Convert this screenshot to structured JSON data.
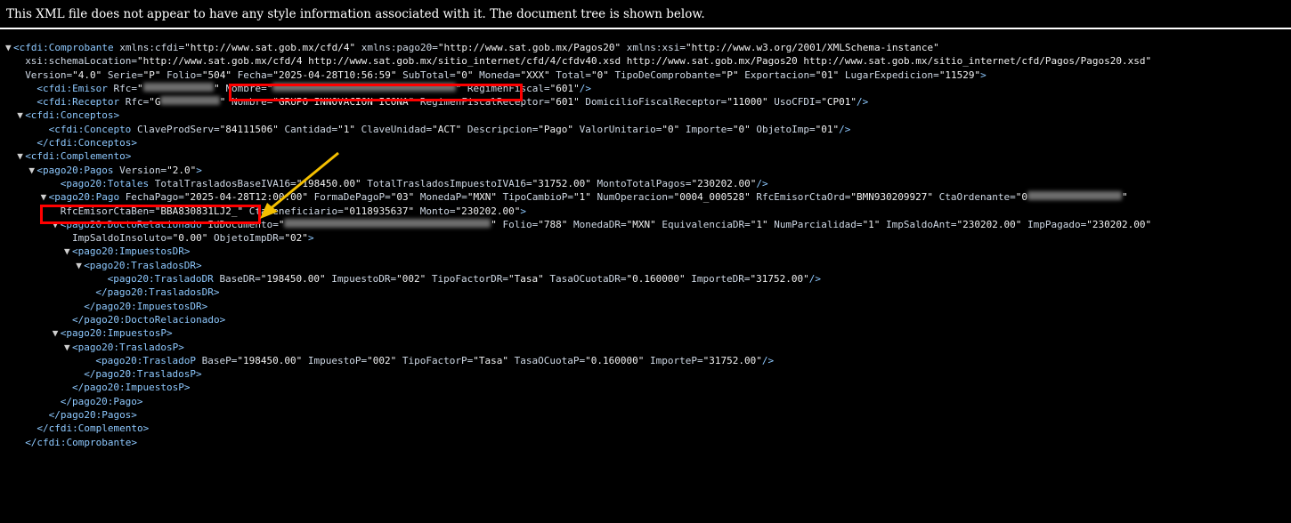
{
  "banner": "This XML file does not appear to have any style information associated with it. The document tree is shown below.",
  "lines": [
    {
      "t": "▼",
      "i": 0,
      "parts": [
        {
          "k": "tag",
          "v": "<cfdi:Comprobante "
        },
        {
          "k": "an",
          "v": "xmlns:cfdi="
        },
        {
          "k": "av",
          "v": "\"http://www.sat.gob.mx/cfd/4\""
        },
        {
          "k": "an",
          "v": " xmlns:pago20="
        },
        {
          "k": "av",
          "v": "\"http://www.sat.gob.mx/Pagos20\""
        },
        {
          "k": "an",
          "v": " xmlns:xsi="
        },
        {
          "k": "av",
          "v": "\"http://www.w3.org/2001/XMLSchema-instance\""
        }
      ]
    },
    {
      "t": "",
      "i": 1,
      "parts": [
        {
          "k": "an",
          "v": "xsi:schemaLocation="
        },
        {
          "k": "av",
          "v": "\"http://www.sat.gob.mx/cfd/4 http://www.sat.gob.mx/sitio_internet/cfd/4/cfdv40.xsd http://www.sat.gob.mx/Pagos20 http://www.sat.gob.mx/sitio_internet/cfd/Pagos/Pagos20.xsd\""
        }
      ]
    },
    {
      "t": "",
      "i": 1,
      "parts": [
        {
          "k": "an",
          "v": "Version="
        },
        {
          "k": "av",
          "v": "\"4.0\""
        },
        {
          "k": "an",
          "v": " Serie="
        },
        {
          "k": "av",
          "v": "\"P\""
        },
        {
          "k": "an",
          "v": " Folio="
        },
        {
          "k": "av",
          "v": "\"504\""
        },
        {
          "k": "an",
          "v": " Fecha="
        },
        {
          "k": "av",
          "v": "\"2025-04-28T10:56:59\""
        },
        {
          "k": "an",
          "v": " SubTotal="
        },
        {
          "k": "av",
          "v": "\"0\""
        },
        {
          "k": "an",
          "v": " Moneda="
        },
        {
          "k": "av",
          "v": "\"XXX\""
        },
        {
          "k": "an",
          "v": " Total="
        },
        {
          "k": "av",
          "v": "\"0\""
        },
        {
          "k": "an",
          "v": " TipoDeComprobante="
        },
        {
          "k": "av",
          "v": "\"P\""
        },
        {
          "k": "an",
          "v": " Exportacion="
        },
        {
          "k": "av",
          "v": "\"01\""
        },
        {
          "k": "an",
          "v": " LugarExpedicion="
        },
        {
          "k": "av",
          "v": "\"11529\""
        },
        {
          "k": "tag",
          "v": ">"
        }
      ]
    },
    {
      "t": "",
      "i": 2,
      "parts": [
        {
          "k": "tag",
          "v": "<cfdi:Emisor "
        },
        {
          "k": "an",
          "v": "Rfc="
        },
        {
          "k": "av",
          "v": "\""
        },
        {
          "k": "blur",
          "v": "XXXXXXXXXXXX"
        },
        {
          "k": "av",
          "v": "\""
        },
        {
          "k": "an",
          "v": " Nombre="
        },
        {
          "k": "av",
          "v": "\""
        },
        {
          "k": "blur",
          "v": "XXXXXXXXXXXXXXXXXXXXXXXXXXXXXXX"
        },
        {
          "k": "av",
          "v": "\""
        },
        {
          "k": "an",
          "v": " RegimenFiscal="
        },
        {
          "k": "av",
          "v": "\"601\""
        },
        {
          "k": "tag",
          "v": "/>"
        }
      ]
    },
    {
      "t": "",
      "i": 2,
      "parts": [
        {
          "k": "tag",
          "v": "<cfdi:Receptor "
        },
        {
          "k": "an",
          "v": "Rfc="
        },
        {
          "k": "av",
          "v": "\"G"
        },
        {
          "k": "blur",
          "v": "XXXXXXXXXX"
        },
        {
          "k": "av",
          "v": "\""
        },
        {
          "k": "an",
          "v": " Nombre="
        },
        {
          "k": "av",
          "v": "\"GRUPO INNOVACION ICONA\""
        },
        {
          "k": "an",
          "v": " RegimenFiscalReceptor="
        },
        {
          "k": "av",
          "v": "\"601\""
        },
        {
          "k": "an",
          "v": " DomicilioFiscalReceptor="
        },
        {
          "k": "av",
          "v": "\"11000\""
        },
        {
          "k": "an",
          "v": " UsoCFDI="
        },
        {
          "k": "av",
          "v": "\"CP01\""
        },
        {
          "k": "tag",
          "v": "/>"
        }
      ]
    },
    {
      "t": "▼",
      "i": 1,
      "parts": [
        {
          "k": "tag",
          "v": "<cfdi:Conceptos>"
        }
      ]
    },
    {
      "t": "",
      "i": 3,
      "parts": [
        {
          "k": "tag",
          "v": "<cfdi:Concepto "
        },
        {
          "k": "an",
          "v": "ClaveProdServ="
        },
        {
          "k": "av",
          "v": "\"84111506\""
        },
        {
          "k": "an",
          "v": " Cantidad="
        },
        {
          "k": "av",
          "v": "\"1\""
        },
        {
          "k": "an",
          "v": " ClaveUnidad="
        },
        {
          "k": "av",
          "v": "\"ACT\""
        },
        {
          "k": "an",
          "v": " Descripcion="
        },
        {
          "k": "av",
          "v": "\"Pago\""
        },
        {
          "k": "an",
          "v": " ValorUnitario="
        },
        {
          "k": "av",
          "v": "\"0\""
        },
        {
          "k": "an",
          "v": " Importe="
        },
        {
          "k": "av",
          "v": "\"0\""
        },
        {
          "k": "an",
          "v": " ObjetoImp="
        },
        {
          "k": "av",
          "v": "\"01\""
        },
        {
          "k": "tag",
          "v": "/>"
        }
      ]
    },
    {
      "t": "",
      "i": 2,
      "parts": [
        {
          "k": "tag",
          "v": "</cfdi:Conceptos>"
        }
      ]
    },
    {
      "t": "▼",
      "i": 1,
      "parts": [
        {
          "k": "tag",
          "v": "<cfdi:Complemento>"
        }
      ]
    },
    {
      "t": "▼",
      "i": 2,
      "parts": [
        {
          "k": "tag",
          "v": "<pago20:Pagos "
        },
        {
          "k": "an",
          "v": "Version="
        },
        {
          "k": "av",
          "v": "\"2.0\""
        },
        {
          "k": "tag",
          "v": ">"
        }
      ]
    },
    {
      "t": "",
      "i": 4,
      "parts": [
        {
          "k": "tag",
          "v": "<pago20:Totales "
        },
        {
          "k": "an",
          "v": "TotalTrasladosBaseIVA16="
        },
        {
          "k": "av",
          "v": "\"198450.00\""
        },
        {
          "k": "an",
          "v": " TotalTrasladosImpuestoIVA16="
        },
        {
          "k": "av",
          "v": "\"31752.00\""
        },
        {
          "k": "an",
          "v": " MontoTotalPagos="
        },
        {
          "k": "av",
          "v": "\"230202.00\""
        },
        {
          "k": "tag",
          "v": "/>"
        }
      ]
    },
    {
      "t": "▼",
      "i": 3,
      "parts": [
        {
          "k": "tag",
          "v": "<pago20:Pago "
        },
        {
          "k": "an",
          "v": "FechaPago="
        },
        {
          "k": "av",
          "v": "\"2025-04-28T12:00:00\""
        },
        {
          "k": "an",
          "v": " FormaDePagoP="
        },
        {
          "k": "av",
          "v": "\"03\""
        },
        {
          "k": "an",
          "v": " MonedaP="
        },
        {
          "k": "av",
          "v": "\"MXN\""
        },
        {
          "k": "an",
          "v": " TipoCambioP="
        },
        {
          "k": "av",
          "v": "\"1\""
        },
        {
          "k": "an",
          "v": " NumOperacion="
        },
        {
          "k": "av",
          "v": "\"0004_000528\""
        },
        {
          "k": "an",
          "v": " RfcEmisorCtaOrd="
        },
        {
          "k": "av",
          "v": "\"BMN930209927\""
        },
        {
          "k": "an",
          "v": " CtaOrdenante="
        },
        {
          "k": "av",
          "v": "\"0"
        },
        {
          "k": "blur",
          "v": "XXXXXXXXXXXXXXXX"
        },
        {
          "k": "av",
          "v": "\""
        }
      ]
    },
    {
      "t": "",
      "i": 4,
      "parts": [
        {
          "k": "an",
          "v": "RfcEmisorCtaBen="
        },
        {
          "k": "av",
          "v": "\"BBA830831LJ2_\""
        },
        {
          "k": "an",
          "v": " CtaBeneficiario="
        },
        {
          "k": "av",
          "v": "\"0118935637\""
        },
        {
          "k": "an",
          "v": " Monto="
        },
        {
          "k": "av",
          "v": "\"230202.00\""
        },
        {
          "k": "tag",
          "v": ">"
        }
      ]
    },
    {
      "t": "▼",
      "i": 4,
      "parts": [
        {
          "k": "tag",
          "v": "<pago20:DoctoRelacionado "
        },
        {
          "k": "an",
          "v": "IdDocumento="
        },
        {
          "k": "av",
          "v": "\""
        },
        {
          "k": "blur",
          "v": "XXXXXXXXXXXXXXXXXXXXXXXXXXXXXXXXXXX"
        },
        {
          "k": "av",
          "v": "\""
        },
        {
          "k": "an",
          "v": " Folio="
        },
        {
          "k": "av",
          "v": "\"788\""
        },
        {
          "k": "an",
          "v": " MonedaDR="
        },
        {
          "k": "av",
          "v": "\"MXN\""
        },
        {
          "k": "an",
          "v": " EquivalenciaDR="
        },
        {
          "k": "av",
          "v": "\"1\""
        },
        {
          "k": "an",
          "v": " NumParcialidad="
        },
        {
          "k": "av",
          "v": "\"1\""
        },
        {
          "k": "an",
          "v": " ImpSaldoAnt="
        },
        {
          "k": "av",
          "v": "\"230202.00\""
        },
        {
          "k": "an",
          "v": " ImpPagado="
        },
        {
          "k": "av",
          "v": "\"230202.00\""
        }
      ]
    },
    {
      "t": "",
      "i": 5,
      "parts": [
        {
          "k": "an",
          "v": "ImpSaldoInsoluto="
        },
        {
          "k": "av",
          "v": "\"0.00\""
        },
        {
          "k": "an",
          "v": " ObjetoImpDR="
        },
        {
          "k": "av",
          "v": "\"02\""
        },
        {
          "k": "tag",
          "v": ">"
        }
      ]
    },
    {
      "t": "▼",
      "i": 5,
      "parts": [
        {
          "k": "tag",
          "v": "<pago20:ImpuestosDR>"
        }
      ]
    },
    {
      "t": "▼",
      "i": 6,
      "parts": [
        {
          "k": "tag",
          "v": "<pago20:TrasladosDR>"
        }
      ]
    },
    {
      "t": "",
      "i": 8,
      "parts": [
        {
          "k": "tag",
          "v": "<pago20:TrasladoDR "
        },
        {
          "k": "an",
          "v": "BaseDR="
        },
        {
          "k": "av",
          "v": "\"198450.00\""
        },
        {
          "k": "an",
          "v": " ImpuestoDR="
        },
        {
          "k": "av",
          "v": "\"002\""
        },
        {
          "k": "an",
          "v": " TipoFactorDR="
        },
        {
          "k": "av",
          "v": "\"Tasa\""
        },
        {
          "k": "an",
          "v": " TasaOCuotaDR="
        },
        {
          "k": "av",
          "v": "\"0.160000\""
        },
        {
          "k": "an",
          "v": " ImporteDR="
        },
        {
          "k": "av",
          "v": "\"31752.00\""
        },
        {
          "k": "tag",
          "v": "/>"
        }
      ]
    },
    {
      "t": "",
      "i": 7,
      "parts": [
        {
          "k": "tag",
          "v": "</pago20:TrasladosDR>"
        }
      ]
    },
    {
      "t": "",
      "i": 6,
      "parts": [
        {
          "k": "tag",
          "v": "</pago20:ImpuestosDR>"
        }
      ]
    },
    {
      "t": "",
      "i": 5,
      "parts": [
        {
          "k": "tag",
          "v": "</pago20:DoctoRelacionado>"
        }
      ]
    },
    {
      "t": "▼",
      "i": 4,
      "parts": [
        {
          "k": "tag",
          "v": "<pago20:ImpuestosP>"
        }
      ]
    },
    {
      "t": "▼",
      "i": 5,
      "parts": [
        {
          "k": "tag",
          "v": "<pago20:TrasladosP>"
        }
      ]
    },
    {
      "t": "",
      "i": 7,
      "parts": [
        {
          "k": "tag",
          "v": "<pago20:TrasladoP "
        },
        {
          "k": "an",
          "v": "BaseP="
        },
        {
          "k": "av",
          "v": "\"198450.00\""
        },
        {
          "k": "an",
          "v": " ImpuestoP="
        },
        {
          "k": "av",
          "v": "\"002\""
        },
        {
          "k": "an",
          "v": " TipoFactorP="
        },
        {
          "k": "av",
          "v": "\"Tasa\""
        },
        {
          "k": "an",
          "v": " TasaOCuotaP="
        },
        {
          "k": "av",
          "v": "\"0.160000\""
        },
        {
          "k": "an",
          "v": " ImporteP="
        },
        {
          "k": "av",
          "v": "\"31752.00\""
        },
        {
          "k": "tag",
          "v": "/>"
        }
      ]
    },
    {
      "t": "",
      "i": 6,
      "parts": [
        {
          "k": "tag",
          "v": "</pago20:TrasladosP>"
        }
      ]
    },
    {
      "t": "",
      "i": 5,
      "parts": [
        {
          "k": "tag",
          "v": "</pago20:ImpuestosP>"
        }
      ]
    },
    {
      "t": "",
      "i": 4,
      "parts": [
        {
          "k": "tag",
          "v": "</pago20:Pago>"
        }
      ]
    },
    {
      "t": "",
      "i": 3,
      "parts": [
        {
          "k": "tag",
          "v": "</pago20:Pagos>"
        }
      ]
    },
    {
      "t": "",
      "i": 2,
      "parts": [
        {
          "k": "tag",
          "v": "</cfdi:Complemento>"
        }
      ]
    },
    {
      "t": "",
      "i": 1,
      "parts": [
        {
          "k": "tag",
          "v": "</cfdi:Comprobante>"
        }
      ]
    }
  ],
  "colors": {
    "highlight": "#ff0000",
    "arrow": "#f5c000",
    "tag": "#8ec9ff",
    "background": "#000000"
  },
  "icons": {
    "toggle": "expand-triangle-icon",
    "arrow": "arrow-pointer-icon"
  }
}
